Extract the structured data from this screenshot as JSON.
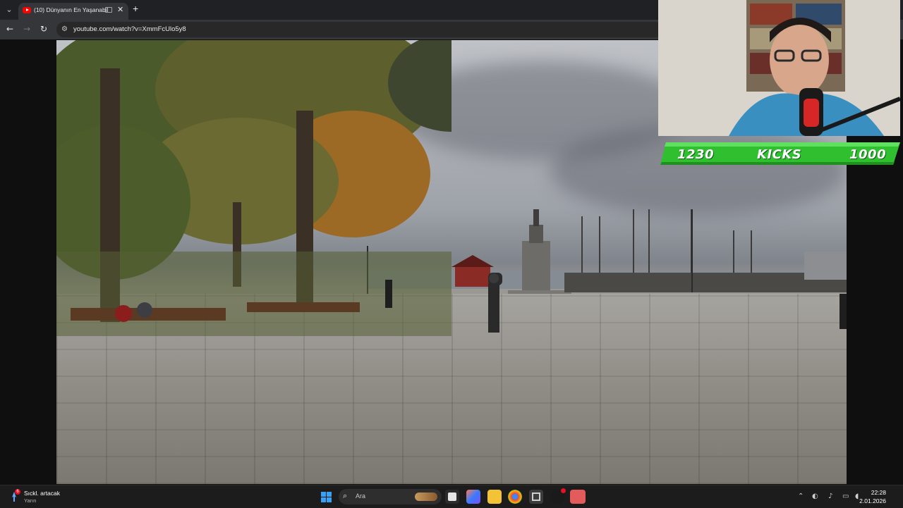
{
  "browser": {
    "tab_title": "(10) Dünyanın En Yaşanabil",
    "url": "youtube.com/watch?v=XmmFcUlo5y8",
    "colors": {
      "chrome": "#202124",
      "toolbar": "#35363a",
      "youtube_red": "#ff0000"
    }
  },
  "overlay": {
    "left_score": "1230",
    "label": "KICKS",
    "right_score": "1000",
    "scoreboard_color": "#2fbf2f"
  },
  "taskbar": {
    "weather_badge": "6",
    "weather_title": "Sıckl. artacak",
    "weather_subtitle": "Yarın",
    "search_placeholder": "Ara",
    "time": "22:28",
    "date": "2.01.2026",
    "apps": [
      "windows-start-icon",
      "file-explorer-icon",
      "copilot-icon",
      "folder-icon",
      "chrome-icon",
      "snipping-tool-icon",
      "obs-icon",
      "streaming-app-icon"
    ]
  }
}
